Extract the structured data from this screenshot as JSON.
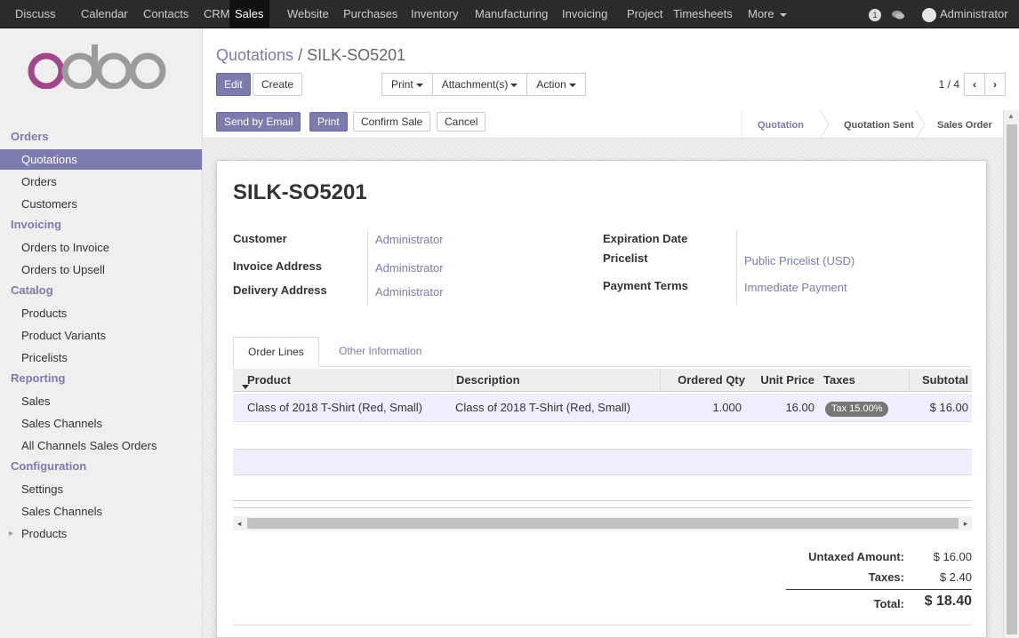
{
  "topbar": {
    "apps": [
      "Discuss",
      "Calendar",
      "Contacts",
      "CRM",
      "Sales",
      "Website",
      "Purchases",
      "Inventory",
      "Manufacturing",
      "Invoicing",
      "Project",
      "Timesheets",
      "More"
    ],
    "active_app": "Sales",
    "notification_count": "1",
    "user": "Administrator"
  },
  "sidebar": {
    "logo": "odoo",
    "sections": [
      {
        "title": "Orders",
        "items": [
          "Quotations",
          "Orders",
          "Customers"
        ]
      },
      {
        "title": "Invoicing",
        "items": [
          "Orders to Invoice",
          "Orders to Upsell"
        ]
      },
      {
        "title": "Catalog",
        "items": [
          "Products",
          "Product Variants",
          "Pricelists"
        ]
      },
      {
        "title": "Reporting",
        "items": [
          "Sales",
          "Sales Channels",
          "All Channels Sales Orders"
        ]
      },
      {
        "title": "Configuration",
        "items": [
          "Settings",
          "Sales Channels",
          "Products"
        ]
      }
    ],
    "active_item": "Quotations"
  },
  "breadcrumb": {
    "parent": "Quotations",
    "separator": "/",
    "current": "SILK-SO5201"
  },
  "toolbar": {
    "edit": "Edit",
    "create": "Create",
    "print": "Print",
    "attachments": "Attachment(s)",
    "action": "Action"
  },
  "pager": {
    "value": "1 / 4"
  },
  "actions": {
    "send_email": "Send by Email",
    "print": "Print",
    "confirm": "Confirm Sale",
    "cancel": "Cancel"
  },
  "status": {
    "steps": [
      "Quotation",
      "Quotation Sent",
      "Sales Order"
    ],
    "current": "Quotation"
  },
  "order": {
    "name": "SILK-SO5201",
    "customer_label": "Customer",
    "customer": "Administrator",
    "invoice_address_label": "Invoice Address",
    "invoice_address": "Administrator",
    "delivery_address_label": "Delivery Address",
    "delivery_address": "Administrator",
    "expiration_label": "Expiration Date",
    "pricelist_label": "Pricelist",
    "pricelist": "Public Pricelist (USD)",
    "payment_terms_label": "Payment Terms",
    "payment_terms": "Immediate Payment"
  },
  "tabs": [
    "Order Lines",
    "Other Information"
  ],
  "lines": {
    "headers": [
      "Product",
      "Description",
      "Ordered Qty",
      "Unit Price",
      "Taxes",
      "Subtotal"
    ],
    "rows": [
      {
        "product": "Class of 2018 T-Shirt (Red, Small)",
        "description": "Class of 2018 T-Shirt (Red, Small)",
        "qty": "1.000",
        "unit_price": "16.00",
        "taxes": "Tax 15.00%",
        "subtotal": "$ 16.00"
      }
    ]
  },
  "totals": {
    "untaxed_label": "Untaxed Amount:",
    "untaxed": "$ 16.00",
    "taxes_label": "Taxes:",
    "taxes": "$ 2.40",
    "total_label": "Total:",
    "total": "$ 18.40"
  },
  "colors": {
    "brand": "#7c7bad",
    "topbar": "#2b2b2b"
  }
}
